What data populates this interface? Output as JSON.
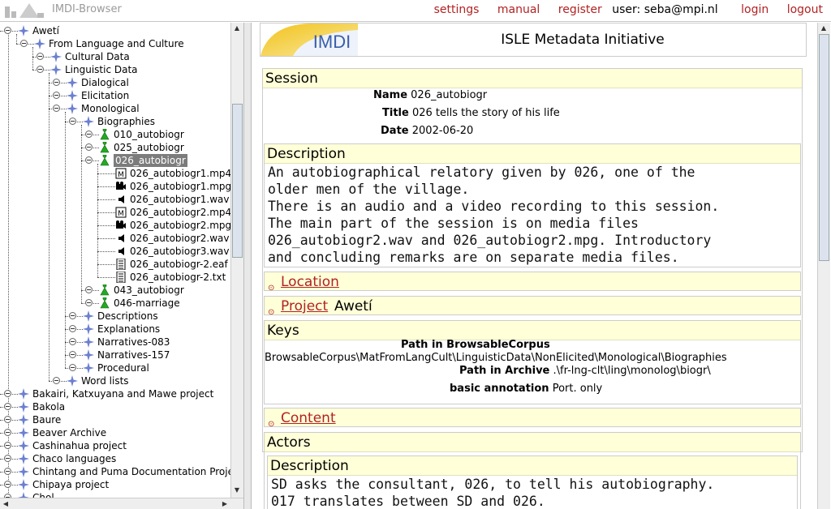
{
  "app": {
    "title": "IMDI-Browser"
  },
  "topnav": {
    "settings": "settings",
    "manual": "manual",
    "register": "register",
    "user": "user: seba@mpi.nl",
    "login": "login",
    "logout": "logout"
  },
  "tree": [
    {
      "label": "Awetí",
      "level": 0,
      "type": "corpus",
      "toggle": true
    },
    {
      "label": "From Language and Culture",
      "level": 1,
      "type": "corpus",
      "toggle": true
    },
    {
      "label": "Cultural Data",
      "level": 2,
      "type": "corpus",
      "toggle": true
    },
    {
      "label": "Linguistic Data",
      "level": 2,
      "type": "corpus",
      "toggle": true
    },
    {
      "label": "Dialogical",
      "level": 3,
      "type": "corpus",
      "toggle": true
    },
    {
      "label": "Elicitation",
      "level": 3,
      "type": "corpus",
      "toggle": true
    },
    {
      "label": "Monological",
      "level": 3,
      "type": "corpus",
      "toggle": true
    },
    {
      "label": "Biographies",
      "level": 4,
      "type": "corpus",
      "toggle": true
    },
    {
      "label": "010_autobiogr",
      "level": 5,
      "type": "session",
      "toggle": true
    },
    {
      "label": "025_autobiogr",
      "level": 5,
      "type": "session",
      "toggle": true
    },
    {
      "label": "026_autobiogr",
      "level": 5,
      "type": "session-open",
      "toggle": true,
      "selected": true
    },
    {
      "label": "026_autobiogr1.mp4",
      "level": 6,
      "type": "mp4"
    },
    {
      "label": "026_autobiogr1.mpg",
      "level": 6,
      "type": "mpg"
    },
    {
      "label": "026_autobiogr1.wav",
      "level": 6,
      "type": "wav"
    },
    {
      "label": "026_autobiogr2.mp4",
      "level": 6,
      "type": "mp4"
    },
    {
      "label": "026_autobiogr2.mpg",
      "level": 6,
      "type": "mpg"
    },
    {
      "label": "026_autobiogr2.wav",
      "level": 6,
      "type": "wav"
    },
    {
      "label": "026_autobiogr3.wav",
      "level": 6,
      "type": "wav"
    },
    {
      "label": "026_autobiogr-2.eaf",
      "level": 6,
      "type": "doc"
    },
    {
      "label": "026_autobiogr-2.txt",
      "level": 6,
      "type": "doc"
    },
    {
      "label": "043_autobiogr",
      "level": 5,
      "type": "session",
      "toggle": true
    },
    {
      "label": "046-marriage",
      "level": 5,
      "type": "session",
      "toggle": true
    },
    {
      "label": "Descriptions",
      "level": 4,
      "type": "corpus",
      "toggle": true
    },
    {
      "label": "Explanations",
      "level": 4,
      "type": "corpus",
      "toggle": true
    },
    {
      "label": "Narratives-083",
      "level": 4,
      "type": "corpus",
      "toggle": true
    },
    {
      "label": "Narratives-157",
      "level": 4,
      "type": "corpus",
      "toggle": true
    },
    {
      "label": "Procedural",
      "level": 4,
      "type": "corpus",
      "toggle": true
    },
    {
      "label": "Word lists",
      "level": 3,
      "type": "corpus",
      "toggle": true
    },
    {
      "label": "Bakairi, Katxuyana and Mawe project",
      "level": 0,
      "type": "corpus",
      "toggle": true
    },
    {
      "label": "Bakola",
      "level": 0,
      "type": "corpus",
      "toggle": true
    },
    {
      "label": "Baure",
      "level": 0,
      "type": "corpus",
      "toggle": true
    },
    {
      "label": "Beaver Archive",
      "level": 0,
      "type": "corpus",
      "toggle": true
    },
    {
      "label": "Cashinahua project",
      "level": 0,
      "type": "corpus",
      "toggle": true
    },
    {
      "label": "Chaco languages",
      "level": 0,
      "type": "corpus",
      "toggle": true
    },
    {
      "label": "Chintang and Puma Documentation Project",
      "level": 0,
      "type": "corpus",
      "toggle": true
    },
    {
      "label": "Chipaya project",
      "level": 0,
      "type": "corpus",
      "toggle": true
    },
    {
      "label": "Chol",
      "level": 0,
      "type": "corpus",
      "toggle": true
    }
  ],
  "header": {
    "logo_text": "IMDI",
    "title": "ISLE Metadata Initiative"
  },
  "session": {
    "heading": "Session",
    "name_label": "Name",
    "name_value": "026_autobiogr",
    "title_label": "Title",
    "title_value": "026 tells the story of his life",
    "date_label": "Date",
    "date_value": "2002-06-20"
  },
  "description": {
    "heading": "Description",
    "lines": [
      "An autobiographical relatory given by 026, one of the",
      "older men of the village.",
      "There is an audio and a video recording to this session.",
      "The main part of the session is on media files",
      "026_autobiogr2.wav and 026_autobiogr2.mpg. Introductory",
      "and concluding remarks are on separate media files."
    ]
  },
  "location": {
    "label": "Location"
  },
  "project": {
    "label": "Project",
    "value": "Awetí"
  },
  "keys": {
    "heading": "Keys",
    "path_browsable_label": "Path in BrowsableCorpus",
    "path_browsable_value": "BrowsableCorpus\\MatFromLangCult\\LinguisticData\\NonElicited\\Monological\\Biographies",
    "path_archive_label": "Path in Archive",
    "path_archive_value": ".\\fr-lng-clt\\ling\\monolog\\biogr\\",
    "annotation_label": "basic annotation",
    "annotation_value": "Port. only"
  },
  "content": {
    "label": "Content"
  },
  "actors": {
    "heading": "Actors",
    "desc_heading": "Description",
    "lines": [
      "SD asks the consultant, 026, to tell his autobiography.",
      "017 translates between SD and 026."
    ]
  },
  "colors": {
    "link": "#b22222",
    "panel_header": "#ffffd8",
    "selected": "#7c7c7c",
    "corpus_icon": "#6c7fd0",
    "session_icon": "#22aa22"
  }
}
